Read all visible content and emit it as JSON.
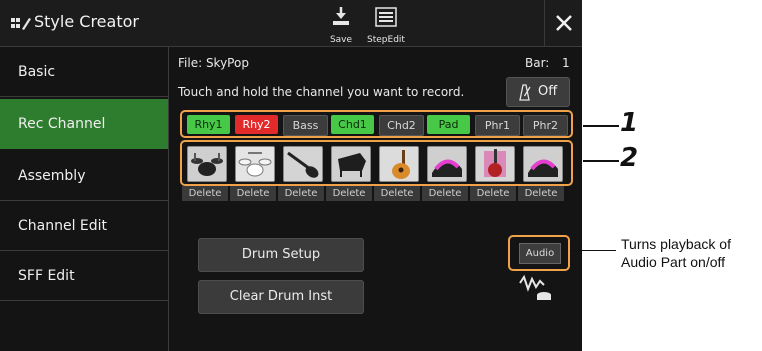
{
  "titlebar": {
    "title": "Style Creator",
    "save_label": "Save",
    "stepedit_label": "StepEdit"
  },
  "sidebar": {
    "items": [
      {
        "label": "Basic",
        "active": false
      },
      {
        "label": "Rec Channel",
        "active": true
      },
      {
        "label": "Assembly",
        "active": false
      },
      {
        "label": "Channel Edit",
        "active": false
      },
      {
        "label": "SFF Edit",
        "active": false
      }
    ]
  },
  "main": {
    "file_label": "File: SkyPop",
    "bar_label": "Bar:",
    "bar_value": "1",
    "instruction": "Touch and hold the channel you want to record.",
    "metronome_label": "Off",
    "channels": [
      {
        "label": "Rhy1",
        "state": "green"
      },
      {
        "label": "Rhy2",
        "state": "red"
      },
      {
        "label": "Bass",
        "state": "off"
      },
      {
        "label": "Chd1",
        "state": "green"
      },
      {
        "label": "Chd2",
        "state": "off"
      },
      {
        "label": "Pad",
        "state": "green"
      },
      {
        "label": "Phr1",
        "state": "off"
      },
      {
        "label": "Phr2",
        "state": "off"
      }
    ],
    "instrument_icons": [
      "drum-kit-icon",
      "drum-kit-icon",
      "electric-bass-icon",
      "grand-piano-icon",
      "acoustic-guitar-icon",
      "synth-pad-icon",
      "electric-guitar-icon",
      "synth-pad-icon"
    ],
    "delete_label": "Delete",
    "drum_setup_label": "Drum Setup",
    "clear_drum_label": "Clear Drum Inst",
    "audio_label": "Audio"
  },
  "callouts": {
    "one": "1",
    "two": "2",
    "annotation_line1": "Turns playback of",
    "annotation_line2": "Audio Part on/off"
  },
  "colors": {
    "green": "#47c847",
    "red": "#e32a2a",
    "off": "#3c3c3c",
    "accent_orange": "#f0a24a",
    "sidebar_active": "#2e7d2e"
  }
}
